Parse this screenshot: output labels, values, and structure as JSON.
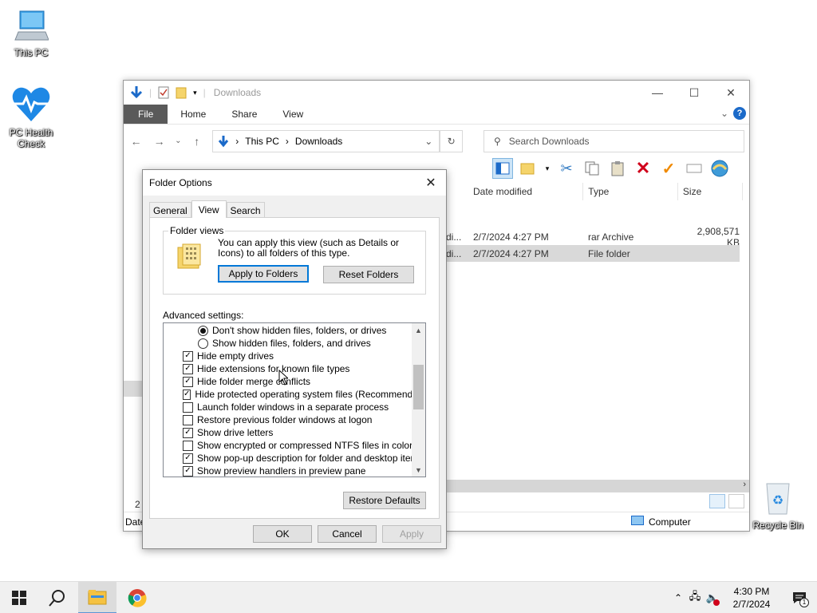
{
  "desktop": {
    "icons": [
      {
        "label": "This PC"
      },
      {
        "label": "PC Health Check"
      },
      {
        "label": "Recycle Bin"
      }
    ]
  },
  "explorer": {
    "title": "Downloads",
    "ribbon_tabs": [
      "File",
      "Home",
      "Share",
      "View"
    ],
    "breadcrumb": [
      "This PC",
      "Downloads"
    ],
    "search_placeholder": "Search Downloads",
    "columns": [
      "Date modified",
      "Type",
      "Size"
    ],
    "files": [
      {
        "name_fragment": "di...",
        "date": "2/7/2024 4:27 PM",
        "type": "rar Archive",
        "size": "2,908,571 KB"
      },
      {
        "name_fragment": "di...",
        "date": "2/7/2024 4:27 PM",
        "type": "File folder",
        "size": ""
      }
    ],
    "status_left": "2",
    "status_left2": "Date",
    "status_right": "Computer"
  },
  "dialog": {
    "title": "Folder Options",
    "tabs": [
      "General",
      "View",
      "Search"
    ],
    "folder_views": {
      "legend": "Folder views",
      "description": "You can apply this view (such as Details or Icons) to all folders of this type.",
      "apply_button": "Apply to Folders",
      "reset_button": "Reset Folders"
    },
    "advanced_label": "Advanced settings:",
    "settings": [
      {
        "kind": "radio",
        "checked": true,
        "indent": 2,
        "label": "Don't show hidden files, folders, or drives"
      },
      {
        "kind": "radio",
        "checked": false,
        "indent": 2,
        "label": "Show hidden files, folders, and drives"
      },
      {
        "kind": "check",
        "checked": true,
        "indent": 1,
        "label": "Hide empty drives"
      },
      {
        "kind": "check",
        "checked": true,
        "indent": 1,
        "label": "Hide extensions for known file types"
      },
      {
        "kind": "check",
        "checked": true,
        "indent": 1,
        "label": "Hide folder merge conflicts"
      },
      {
        "kind": "check",
        "checked": true,
        "indent": 1,
        "label": "Hide protected operating system files (Recommended)"
      },
      {
        "kind": "check",
        "checked": false,
        "indent": 1,
        "label": "Launch folder windows in a separate process"
      },
      {
        "kind": "check",
        "checked": false,
        "indent": 1,
        "label": "Restore previous folder windows at logon"
      },
      {
        "kind": "check",
        "checked": true,
        "indent": 1,
        "label": "Show drive letters"
      },
      {
        "kind": "check",
        "checked": false,
        "indent": 1,
        "label": "Show encrypted or compressed NTFS files in color"
      },
      {
        "kind": "check",
        "checked": true,
        "indent": 1,
        "label": "Show pop-up description for folder and desktop items"
      },
      {
        "kind": "check",
        "checked": true,
        "indent": 1,
        "label": "Show preview handlers in preview pane"
      }
    ],
    "restore_defaults": "Restore Defaults",
    "ok": "OK",
    "cancel": "Cancel",
    "apply": "Apply"
  },
  "taskbar": {
    "time": "4:30 PM",
    "date": "2/7/2024",
    "notification_count": "1"
  },
  "colors": {
    "accent": "#0078d7",
    "file_tab": "#5a5a5a",
    "download_arrow": "#1b6ac9"
  }
}
